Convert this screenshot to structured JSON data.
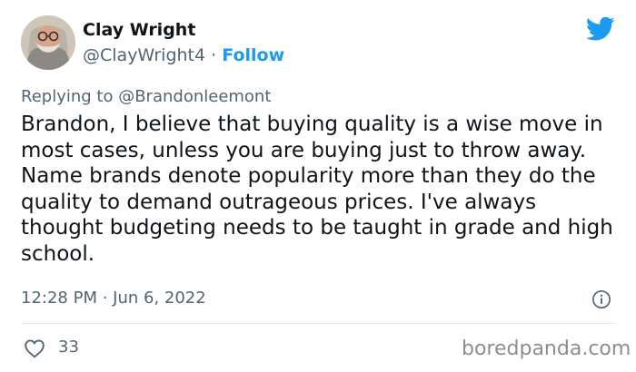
{
  "author": {
    "name": "Clay Wright",
    "handle": "@ClayWright4",
    "separator": " · ",
    "follow_label": "Follow"
  },
  "reply": {
    "prefix": "Replying to ",
    "mention": "@Brandonleemont"
  },
  "tweet": {
    "text": "Brandon, I believe that buying quality is a wise move in most cases, unless you are buying just to throw away. Name brands denote popularity more than they do the quality to demand outrageous prices. I've always thought budgeting needs to be taught in grade and high school.",
    "timestamp": "12:28 PM · Jun 6, 2022",
    "like_count": "33"
  },
  "watermark": "boredpanda.com",
  "colors": {
    "twitter_blue": "#1d9bf0",
    "secondary_text": "#536471"
  },
  "icons": {
    "brand": "twitter-bird-icon",
    "info": "info-icon",
    "like": "heart-outline-icon"
  }
}
